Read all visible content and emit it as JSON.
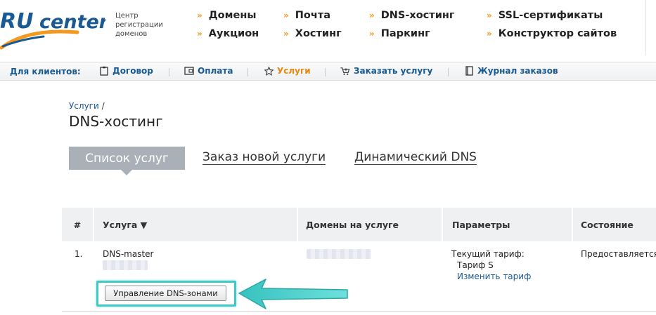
{
  "header": {
    "logo_prefix": "RU",
    "logo_text": "center",
    "logo_sub": [
      "Центр",
      "регистрации",
      "доменов"
    ],
    "nav": [
      [
        "Домены",
        "Аукцион"
      ],
      [
        "Почта",
        "Хостинг"
      ],
      [
        "DNS-хостинг",
        "Паркинг"
      ],
      [
        "SSL-сертификаты",
        "Конструктор сайтов"
      ]
    ],
    "bullet": "»"
  },
  "clientbar": {
    "label": "Для клиентов:",
    "items": [
      {
        "label": "Договор",
        "icon": "clipboard-icon"
      },
      {
        "label": "Оплата",
        "icon": "wallet-icon"
      },
      {
        "label": "Услуги",
        "icon": "star-icon",
        "active": true
      },
      {
        "label": "Заказать услугу",
        "icon": "cart-icon"
      },
      {
        "label": "Журнал заказов",
        "icon": "book-icon"
      }
    ]
  },
  "breadcrumb": {
    "link": "Услуги",
    "sep": " /"
  },
  "page_title": "DNS-хостинг",
  "tabs": {
    "active": "Список услуг",
    "links": [
      "Заказ новой услуги",
      "Динамический DNS"
    ]
  },
  "table": {
    "headers": [
      "#",
      "Услуга ▼",
      "Домены на услуге",
      "Параметры",
      "Состояние"
    ],
    "rows": [
      {
        "num": "1.",
        "service": "DNS-master",
        "params_label": "Текущий тариф:",
        "tariff": "Тариф S",
        "change_tariff": "Изменить тариф",
        "status": "Предоставляется"
      }
    ]
  },
  "manage_button": "Управление DNS-зонами",
  "colors": {
    "accent_blue": "#1a5a94",
    "accent_orange": "#e58a12",
    "highlight_teal": "#3fc9c6",
    "tab_gray": "#a9b0b7"
  }
}
